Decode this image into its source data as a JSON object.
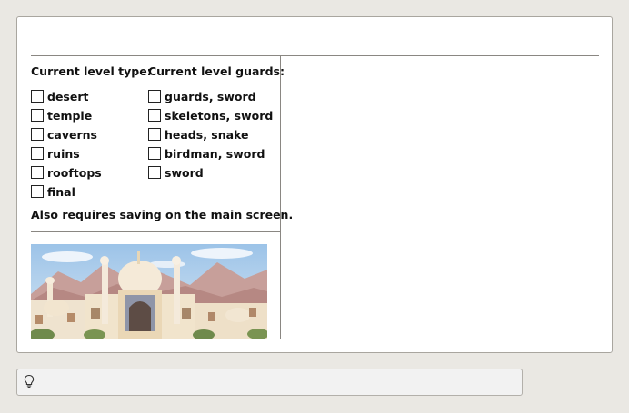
{
  "level_type": {
    "heading": "Current level type:",
    "options": [
      "desert",
      "temple",
      "caverns",
      "ruins",
      "rooftops",
      "final"
    ]
  },
  "level_guards": {
    "heading": "Current level guards:",
    "options": [
      "guards, sword",
      "skeletons, sword",
      "heads, snake",
      "birdman, sword",
      "sword"
    ]
  },
  "note": "Also requires saving on the main screen.",
  "status_bar": {
    "icon": "lightbulb-icon",
    "text": ""
  },
  "colors": {
    "background": "#eae8e3",
    "panel": "#ffffff",
    "rule": "#8a8782"
  }
}
